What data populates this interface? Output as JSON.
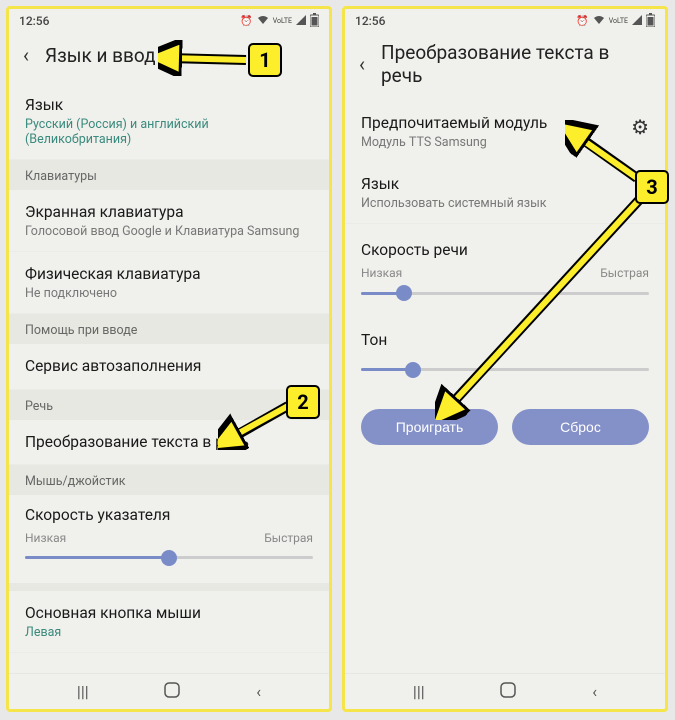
{
  "statusbar": {
    "time": "12:56",
    "icons": [
      "⏰",
      "📶",
      "VoLTE",
      "📶",
      "🔋"
    ]
  },
  "annotations": {
    "a1": "1",
    "a2": "2",
    "a3": "3"
  },
  "left": {
    "header_title": "Язык и ввод",
    "lang_row": {
      "title": "Язык",
      "sub": "Русский (Россия) и английский (Великобритания)"
    },
    "sec_keyboards": "Клавиатуры",
    "row_screen_kbd": {
      "title": "Экранная клавиатура",
      "sub": "Голосовой ввод Google и Клавиатура Samsung"
    },
    "row_phys_kbd": {
      "title": "Физическая клавиатура",
      "sub": "Не подключено"
    },
    "sec_help": "Помощь при вводе",
    "row_autofill": {
      "title": "Сервис автозаполнения"
    },
    "sec_speech": "Речь",
    "row_tts": {
      "title": "Преобразование текста в речь"
    },
    "sec_mouse": "Мышь/джойстик",
    "pointer_speed": {
      "title": "Скорость указателя",
      "low": "Низкая",
      "high": "Быстрая",
      "value_pct": 50
    },
    "row_mouse_primary": {
      "title": "Основная кнопка мыши",
      "sub": "Левая"
    }
  },
  "right": {
    "header_title": "Преобразование текста в речь",
    "engine": {
      "title": "Предпочитаемый модуль",
      "sub": "Модуль TTS Samsung"
    },
    "lang": {
      "title": "Язык",
      "sub": "Использовать системный язык"
    },
    "rate": {
      "title": "Скорость речи",
      "low": "Низкая",
      "high": "Быстрая",
      "value_pct": 15
    },
    "pitch": {
      "title": "Тон",
      "value_pct": 18
    },
    "btn_play": "Проиграть",
    "btn_reset": "Сброс"
  }
}
